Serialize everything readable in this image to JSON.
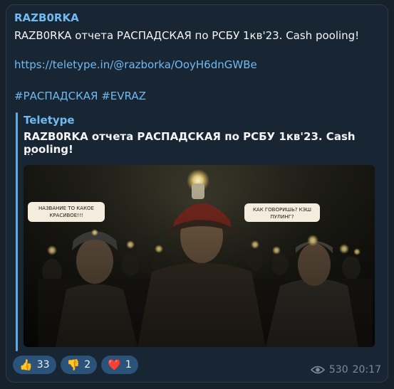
{
  "message": {
    "channel_name": "RAZB0RKA",
    "title": "RAZB0RKA отчета РАСПАДСКАЯ по РСБУ 1кв'23. Cash pooling!",
    "link": "https://teletype.in/@razborka/OoyH6dnGWBe",
    "hashtags": [
      "#РАСПАДСКАЯ",
      "#EVRAZ"
    ]
  },
  "preview": {
    "site_name": "Teletype",
    "title": "RAZB0RKA отчета РАСПАДСКАЯ по РСБУ 1кв'23. Cash pooling!",
    "description": "...",
    "speech_left": "НАЗВАНИЕ ТО КАКОЕ КРАСИВОЕ!!!",
    "speech_right": "КАК ГОВОРИШЬ? КЭШ ПУЛИНГ?"
  },
  "reactions": [
    {
      "emoji": "👍",
      "count": "33"
    },
    {
      "emoji": "👎",
      "count": "2"
    },
    {
      "emoji": "❤️",
      "count": "1"
    }
  ],
  "meta": {
    "views": "530",
    "time": "20:17"
  },
  "colors": {
    "background": "#17212b",
    "bubble": "#182533",
    "accent": "#71baf1",
    "reaction_bg": "#2b5278",
    "meta_text": "#7d8b99"
  }
}
